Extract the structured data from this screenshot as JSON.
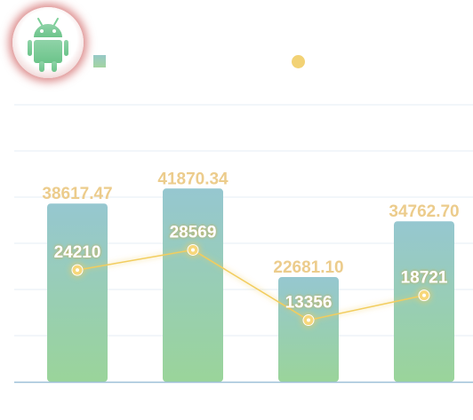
{
  "app": {
    "icon": "android-robot-icon"
  },
  "colors": {
    "bar_top": "#96c7d0",
    "bar_bottom": "#9ad49a",
    "bar_label": "#eccc8c",
    "line": "#f2cd5e",
    "point_fill": "#f7d77a",
    "point_label": "#ffffff",
    "grid": "#e6eef5",
    "axis": "#9ec0d8"
  },
  "legend": {
    "position": "top",
    "bar_label": "",
    "line_label": ""
  },
  "chart_data": {
    "type": "bar",
    "categories": [
      "",
      "",
      "",
      ""
    ],
    "grid": true,
    "ylim": [
      0,
      60000
    ],
    "series": [
      {
        "type": "bar",
        "values": [
          38617.47,
          41870.34,
          22681.1,
          34762.7
        ],
        "labels": [
          "38617.47",
          "41870.34",
          "22681.10",
          "34762.70"
        ]
      },
      {
        "type": "line",
        "values": [
          24210,
          28569,
          13356,
          18721
        ],
        "labels": [
          "24210",
          "28569",
          "13356",
          "18721"
        ]
      }
    ]
  }
}
